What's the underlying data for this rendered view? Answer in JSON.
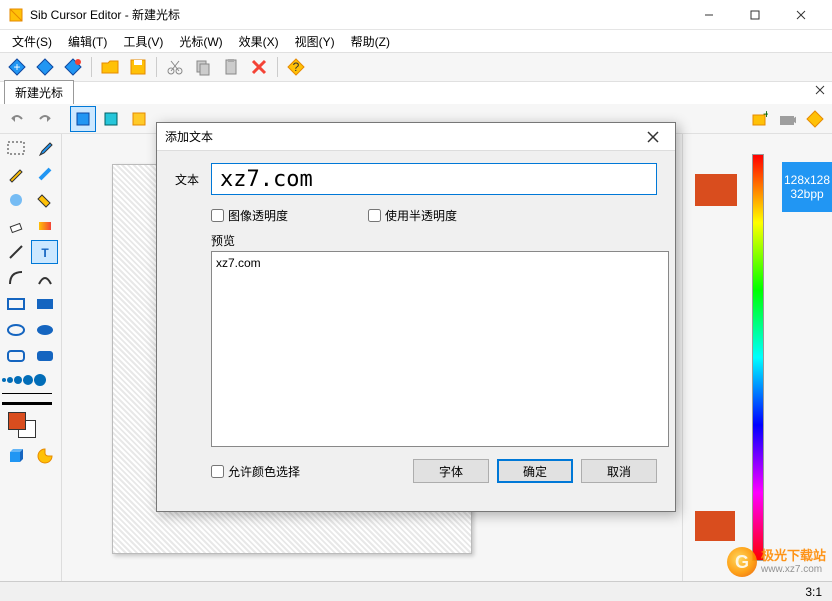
{
  "window": {
    "title": "Sib Cursor Editor - 新建光标"
  },
  "menu": {
    "file": "文件(S)",
    "edit": "编辑(T)",
    "tools": "工具(V)",
    "cursor": "光标(W)",
    "effects": "效果(X)",
    "view": "视图(Y)",
    "help": "帮助(Z)"
  },
  "tabs": {
    "active": "新建光标"
  },
  "format_badge": {
    "size": "128x128",
    "depth": "32bpp"
  },
  "status": {
    "zoom": "3:1"
  },
  "dialog": {
    "title": "添加文本",
    "text_label": "文本",
    "text_value": "xz7.com",
    "check_transparency": "图像透明度",
    "check_semi": "使用半透明度",
    "preview_label": "预览",
    "preview_value": "xz7.com",
    "check_allow_color": "允许颜色选择",
    "btn_font": "字体",
    "btn_ok": "确定",
    "btn_cancel": "取消"
  },
  "watermark": {
    "name": "极光下载站",
    "url": "www.xz7.com"
  }
}
